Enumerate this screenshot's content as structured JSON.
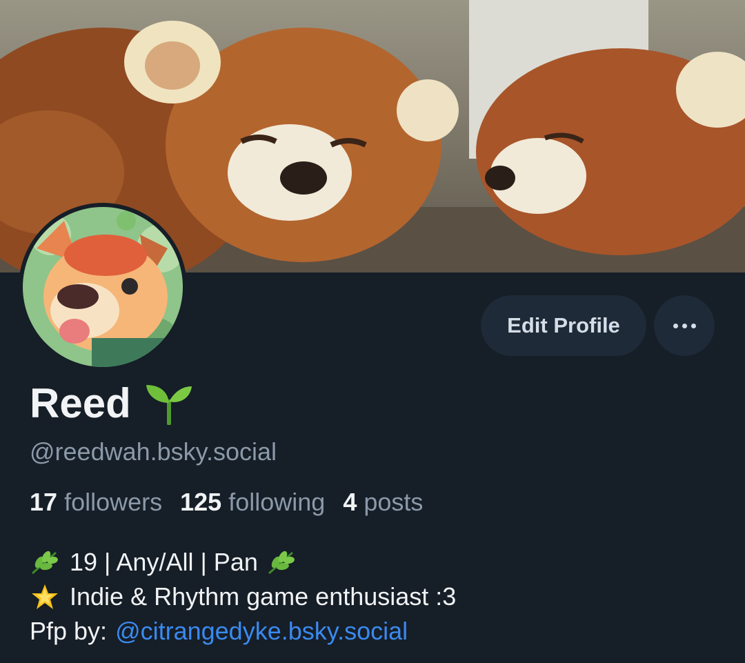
{
  "profile": {
    "display_name": "Reed",
    "name_emoji_icon": "seedling-icon",
    "handle": "@reedwah.bsky.social",
    "stats": {
      "followers_count": "17",
      "followers_label": "followers",
      "following_count": "125",
      "following_label": "following",
      "posts_count": "4",
      "posts_label": "posts"
    },
    "bio": {
      "line1": "19 | Any/All | Pan",
      "line1_icon": "herb-icon",
      "line2": "Indie & Rhythm game enthusiast :3",
      "line2_icon": "glowing-star-icon",
      "line3_prefix": "Pfp by:",
      "line3_link": "@citrangedyke.bsky.social"
    }
  },
  "actions": {
    "edit_profile_label": "Edit Profile",
    "more_icon": "ellipsis-icon"
  },
  "colors": {
    "background": "#161e27",
    "button_bg": "#1e2a38",
    "muted_text": "#8b99a9",
    "link": "#3a8af0"
  }
}
